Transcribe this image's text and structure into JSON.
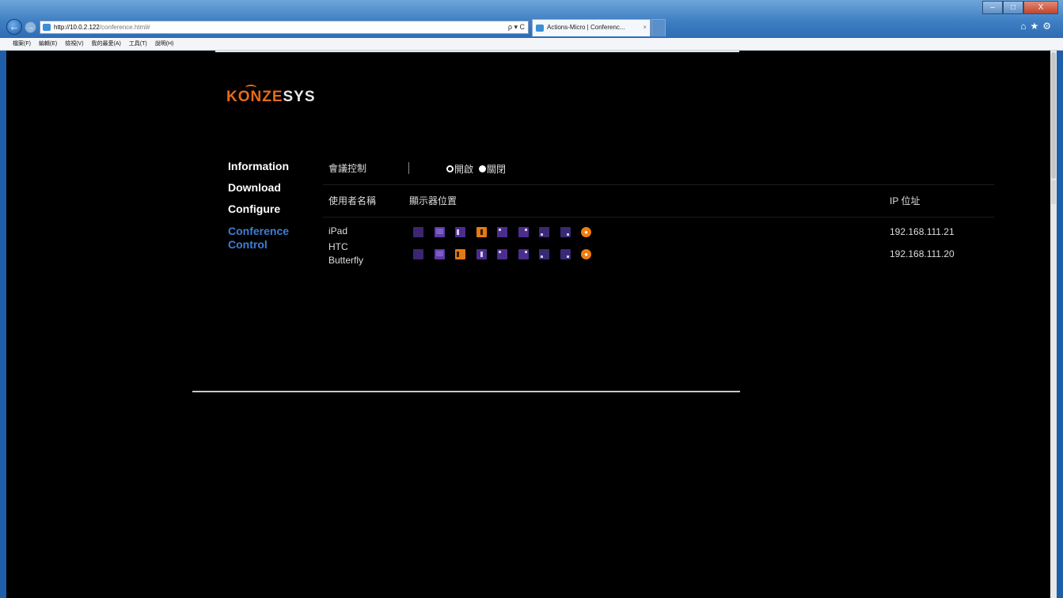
{
  "browser": {
    "address": {
      "host": "http://10.0.2.122",
      "path": "/conference.html#",
      "search_controls": "ρ ▾ C"
    },
    "tab": {
      "title": "Actions-Micro | Conferenc...",
      "close": "×"
    },
    "window_controls": {
      "minimize": "–",
      "maximize": "□",
      "close": "X"
    },
    "nav_icons": {
      "home": "⌂",
      "favorites": "★",
      "tools": "⚙"
    },
    "back_glyph": "←",
    "forward_glyph": "→",
    "menu": [
      "檔案(F)",
      "編輯(E)",
      "檢視(V)",
      "我的最愛(A)",
      "工具(T)",
      "說明(H)"
    ]
  },
  "page": {
    "logo": {
      "part1": "KONZE",
      "part2": "SYS"
    },
    "nav": [
      {
        "label": "Information",
        "active": false
      },
      {
        "label": "Download",
        "active": false
      },
      {
        "label": "Configure",
        "active": false
      },
      {
        "label": "Conference",
        "label2": "Control",
        "active": true
      }
    ],
    "conference_control": {
      "label": "會議控制",
      "option_on": "開啟",
      "option_off": "關閉",
      "selected": "關閉"
    },
    "table": {
      "headers": {
        "user_name": "使用者名稱",
        "display_position": "顯示器位置",
        "ip": "IP 位址"
      },
      "rows": [
        {
          "name": "iPad",
          "active_slot": 3,
          "ip": "192.168.111.21",
          "status_glyph": "●"
        },
        {
          "name": "HTC",
          "name2": "Butterfly",
          "active_slot": 2,
          "ip": "192.168.111.20",
          "status_glyph": "●"
        }
      ]
    },
    "colors": {
      "accent_orange": "#e86a17",
      "active_nav_blue": "#3d7fd6",
      "slot_purple": "#4a2e8c"
    }
  }
}
